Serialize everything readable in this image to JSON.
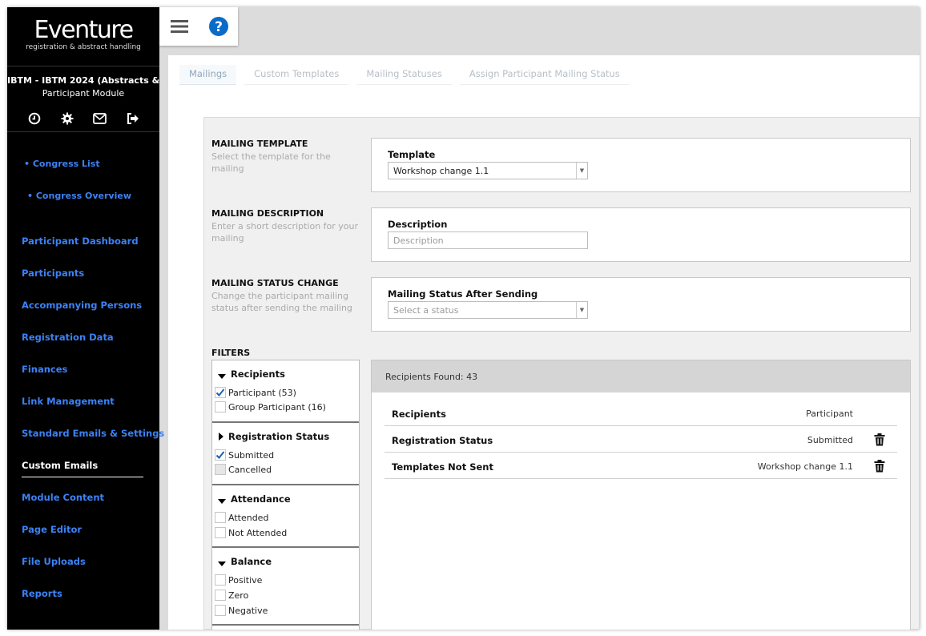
{
  "sidebar": {
    "brand": "Eventure",
    "tagline": "registration & abstract handling",
    "congress": "IBTM - IBTM 2024 (Abstracts & Par...",
    "module": "Participant Module",
    "icons": [
      "dashboard-icon",
      "gear-icon",
      "mail-icon",
      "logout-icon"
    ],
    "links": {
      "congress_list": "• Congress List",
      "congress_overview": "• Congress Overview"
    },
    "items": [
      "Participant Dashboard",
      "Participants",
      "Accompanying Persons",
      "Registration Data",
      "Finances",
      "Link Management",
      "Standard Emails & Settings",
      "Custom Emails",
      "Module Content",
      "Page Editor",
      "File Uploads",
      "Reports"
    ],
    "active_item": "Custom Emails"
  },
  "topbar": {
    "icons": [
      "menu-icon",
      "help-icon"
    ]
  },
  "tabs": [
    "Mailings",
    "Custom Templates",
    "Mailing Statuses",
    "Assign Participant Mailing Status"
  ],
  "active_tab": "Mailings",
  "sections": {
    "template": {
      "title": "MAILING TEMPLATE",
      "desc": "Select the template for the mailing",
      "label": "Template",
      "value": "Workshop change 1.1"
    },
    "description": {
      "title": "MAILING DESCRIPTION",
      "desc": "Enter a short description for your mailing",
      "label": "Description",
      "placeholder": "Description"
    },
    "status_change": {
      "title": "MAILING STATUS CHANGE",
      "desc": "Change the participant mailing status after sending the mailing",
      "label": "Mailing Status After Sending",
      "placeholder": "Select a status"
    }
  },
  "filters": {
    "title": "FILTERS",
    "groups": [
      {
        "name": "Recipients",
        "expanded": true,
        "options": [
          {
            "label": "Participant (53)",
            "checked": true
          },
          {
            "label": "Group Participant (16)",
            "checked": false
          }
        ]
      },
      {
        "name": "Registration Status",
        "expanded": false,
        "options": [
          {
            "label": "Submitted",
            "checked": true
          },
          {
            "label": "Cancelled",
            "checked": false,
            "disabled": true
          }
        ]
      },
      {
        "name": "Attendance",
        "expanded": true,
        "options": [
          {
            "label": "Attended",
            "checked": false
          },
          {
            "label": "Not Attended",
            "checked": false
          }
        ]
      },
      {
        "name": "Balance",
        "expanded": true,
        "options": [
          {
            "label": "Positive",
            "checked": false
          },
          {
            "label": "Zero",
            "checked": false
          },
          {
            "label": "Negative",
            "checked": false
          }
        ]
      }
    ]
  },
  "results": {
    "found": "Recipients Found: 43",
    "rows": [
      {
        "label": "Recipients",
        "value": "Participant",
        "deletable": false
      },
      {
        "label": "Registration Status",
        "value": "Submitted",
        "deletable": true
      },
      {
        "label": "Templates Not Sent",
        "value": "Workshop change 1.1",
        "deletable": true
      }
    ]
  }
}
